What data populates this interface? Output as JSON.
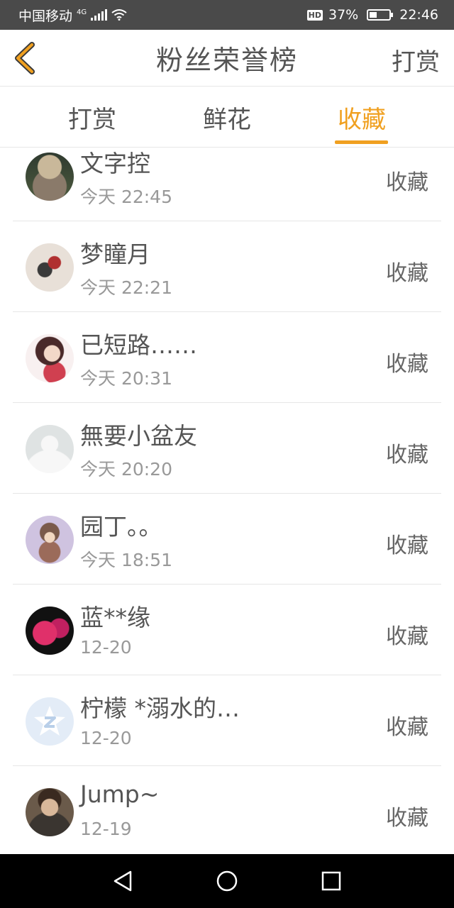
{
  "status_bar": {
    "carrier": "中国移动",
    "network": "4G",
    "hd": "HD",
    "battery": "37%",
    "time": "22:46"
  },
  "header": {
    "title": "粉丝荣誉榜",
    "action": "打赏",
    "back_icon": "chevron-left-icon",
    "accent_color": "#f0a020"
  },
  "tabs": [
    {
      "label": "打赏",
      "active": false
    },
    {
      "label": "鲜花",
      "active": false
    },
    {
      "label": "收藏",
      "active": true
    }
  ],
  "list": [
    {
      "name": "文字控",
      "time": "今天 22:45",
      "action": "收藏"
    },
    {
      "name": "梦瞳月",
      "time": "今天 22:21",
      "action": "收藏"
    },
    {
      "name": "已短路……",
      "time": "今天 20:31",
      "action": "收藏"
    },
    {
      "name": "無要小盆友",
      "time": "今天 20:20",
      "action": "收藏"
    },
    {
      "name": "园丁。。",
      "time": "今天 18:51",
      "action": "收藏"
    },
    {
      "name": "蓝**缘",
      "time": "12-20",
      "action": "收藏"
    },
    {
      "name": "柠檬 *溺水的…",
      "time": "12-20",
      "action": "收藏"
    },
    {
      "name": "Jump~",
      "time": "12-19",
      "action": "收藏"
    }
  ]
}
